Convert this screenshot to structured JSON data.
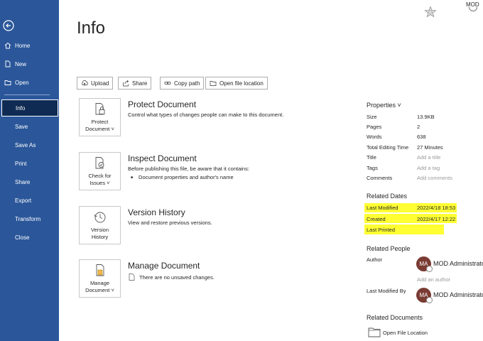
{
  "user_initials": "MOD",
  "sidebar": {
    "items": [
      {
        "label": "Home"
      },
      {
        "label": "New"
      },
      {
        "label": "Open"
      },
      {
        "label": "Info"
      },
      {
        "label": "Save"
      },
      {
        "label": "Save As"
      },
      {
        "label": "Print"
      },
      {
        "label": "Share"
      },
      {
        "label": "Export"
      },
      {
        "label": "Transform"
      },
      {
        "label": "Close"
      }
    ]
  },
  "page_title": "Info",
  "toolbar": {
    "upload": "Upload",
    "share": "Share",
    "copy_path": "Copy path",
    "open_location": "Open file location"
  },
  "sections": {
    "protect": {
      "button": [
        "Protect",
        "Document ˅"
      ],
      "title": "Protect Document",
      "desc": "Control what types of changes people can make to this document."
    },
    "inspect": {
      "button": [
        "Check for",
        "Issues ˅"
      ],
      "title": "Inspect Document",
      "desc": "Before publishing this file, be aware that it contains:",
      "bullet": "Document properties and author's name"
    },
    "version": {
      "button": [
        "Version",
        "History"
      ],
      "title": "Version History",
      "desc": "View and restore previous versions."
    },
    "manage": {
      "button": [
        "Manage",
        "Document ˅"
      ],
      "title": "Manage Document",
      "desc": "There are no unsaved changes."
    }
  },
  "properties": {
    "heading": "Properties ˅",
    "rows": [
      {
        "key": "Size",
        "value": "13.9KB"
      },
      {
        "key": "Pages",
        "value": "2"
      },
      {
        "key": "Words",
        "value": "638"
      },
      {
        "key": "Total Editing Time",
        "value": "27 Minutes"
      },
      {
        "key": "Title",
        "value": "Add a title"
      },
      {
        "key": "Tags",
        "value": "Add a tag"
      },
      {
        "key": "Comments",
        "value": "Add comments"
      }
    ]
  },
  "related_dates": {
    "heading": "Related Dates",
    "last_modified_label": "Last Modified",
    "last_modified": "2022/4/18 18:53",
    "created_label": "Created",
    "created": "2022/4/17 12:22",
    "last_printed_label": "Last Printed"
  },
  "related_people": {
    "heading": "Related People",
    "author_label": "Author",
    "author_initials": "MA",
    "author_name": "MOD Administrator",
    "add_author": "Add an author",
    "last_modified_by_label": "Last Modified By",
    "modifier_initials": "MA",
    "modifier_name": "MOD Administrator"
  },
  "related_documents": {
    "heading": "Related Documents",
    "open_location": "Open File Location"
  },
  "colors": {
    "sidebar": "#2b579a",
    "active": "#0f2b53",
    "highlight": "#ffff33",
    "avatar": "#7a3b33"
  }
}
